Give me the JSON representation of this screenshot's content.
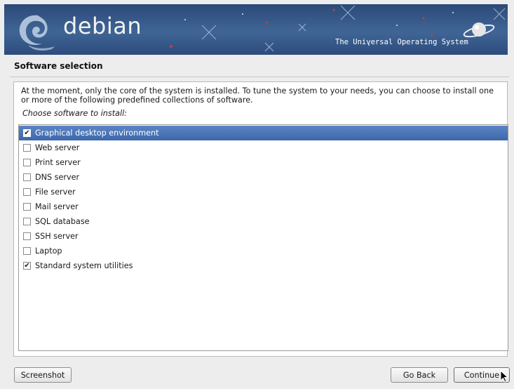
{
  "banner": {
    "brand": "debian",
    "tagline": "The Universal Operating System"
  },
  "page": {
    "title": "Software selection",
    "description": "At the moment, only the core of the system is installed. To tune the system to your needs, you can choose to install one or more of the following predefined collections of software.",
    "prompt": "Choose software to install:"
  },
  "software": [
    {
      "label": "Graphical desktop environment",
      "checked": true,
      "selected": true
    },
    {
      "label": "Web server",
      "checked": false,
      "selected": false
    },
    {
      "label": "Print server",
      "checked": false,
      "selected": false
    },
    {
      "label": "DNS server",
      "checked": false,
      "selected": false
    },
    {
      "label": "File server",
      "checked": false,
      "selected": false
    },
    {
      "label": "Mail server",
      "checked": false,
      "selected": false
    },
    {
      "label": "SQL database",
      "checked": false,
      "selected": false
    },
    {
      "label": "SSH server",
      "checked": false,
      "selected": false
    },
    {
      "label": "Laptop",
      "checked": false,
      "selected": false
    },
    {
      "label": "Standard system utilities",
      "checked": true,
      "selected": false
    }
  ],
  "buttons": {
    "screenshot": "Screenshot",
    "go_back": "Go Back",
    "continue": "Continue"
  },
  "colors": {
    "banner": "#3f6596",
    "selection": "#4a75b8"
  }
}
